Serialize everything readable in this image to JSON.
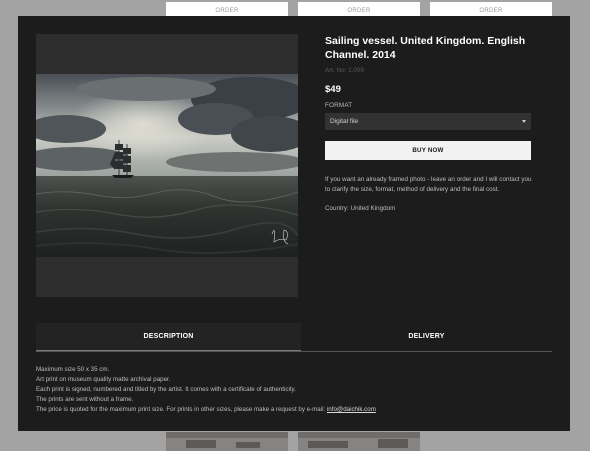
{
  "background": {
    "order_label": "ORDER"
  },
  "product": {
    "title": "Sailing vessel. United Kingdom. English Channel. 2014",
    "art_no": "Art. No: 1.009",
    "price": "$49",
    "format_label": "FORMAT",
    "format_selected": "Digital file",
    "buy_label": "BUY NOW",
    "note": "If you want an already framed photo - leave an order and I will contact you to clarify the size, format, method of delivery and the final cost.",
    "country": "Country: United Kingdom"
  },
  "tabs": [
    {
      "label": "DESCRIPTION",
      "active": true
    },
    {
      "label": "DELIVERY",
      "active": false
    }
  ],
  "description": {
    "lines": [
      "Maximum size 50 x 35 cm.",
      "Art print on museum quality matte archival paper.",
      "Each print is signed, numbered and titled by the artist. It comes with a certificate of authenticity.",
      "The prints are sent without a frame."
    ],
    "last_line_prefix": "The price is quoted for the maximum print size. For prints in other sizes, please make a request by e-mail: ",
    "email": "info@daichik.com"
  },
  "colors": {
    "modal_bg": "#1c1c1c",
    "overlay": "#a3a3a3",
    "button_bg": "#f2f2f2"
  },
  "icons": {
    "select_caret": "chevron-down-icon"
  }
}
